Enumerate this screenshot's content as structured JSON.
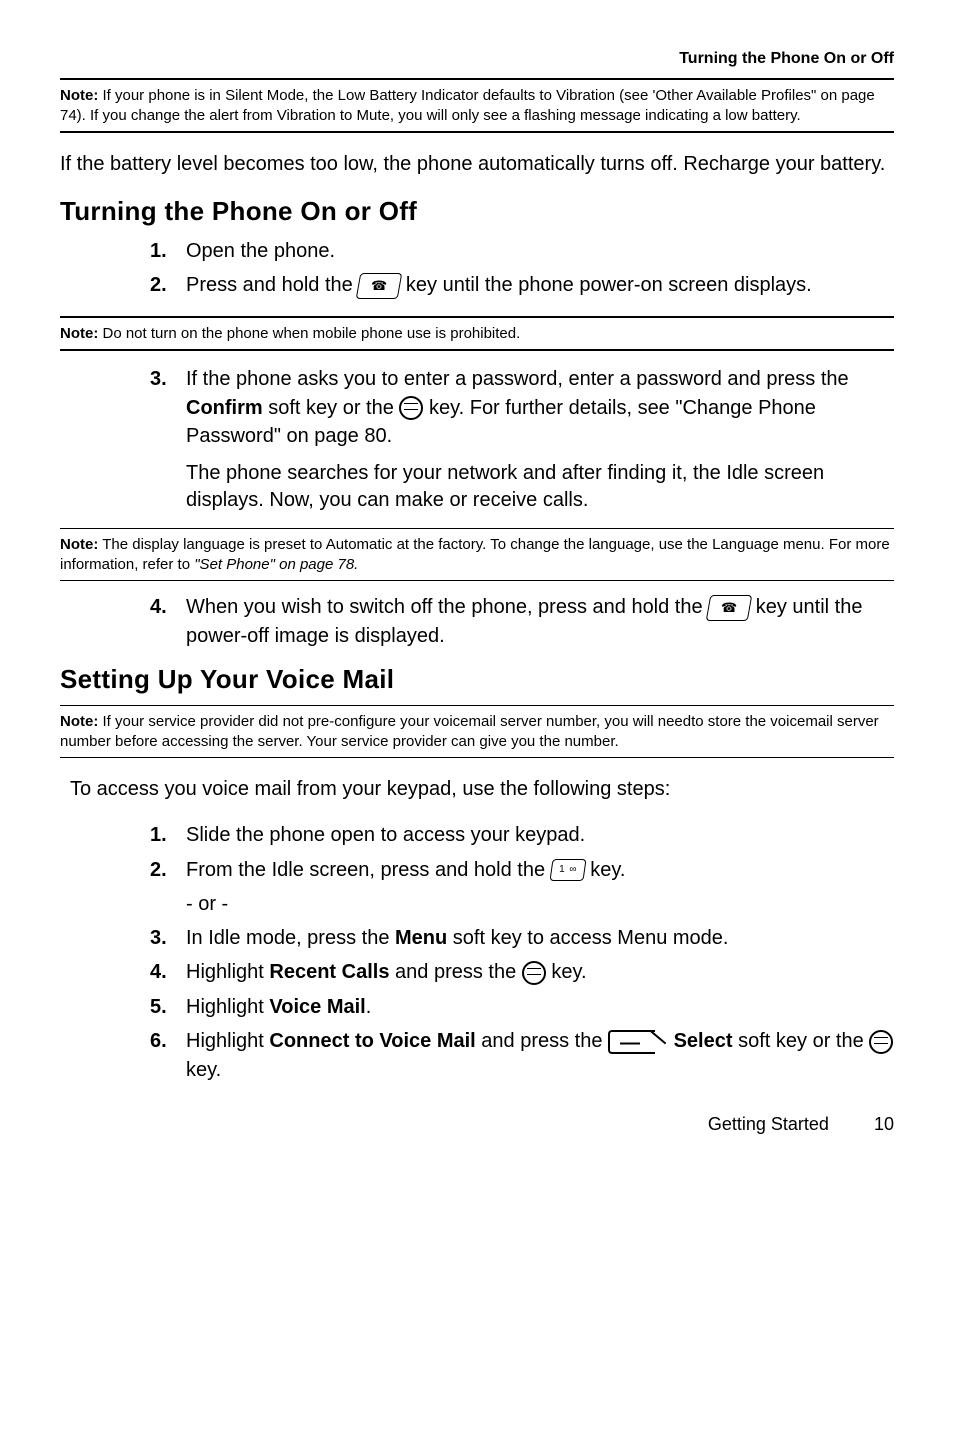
{
  "header": {
    "section_title": "Turning the Phone On or Off"
  },
  "note1": {
    "label": "Note:",
    "text": " If your phone is in Silent Mode, the Low Battery Indicator defaults to Vibration (see 'Other Available Profiles\" on page 74). If you change the alert from Vibration to Mute, you will only see a flashing message indicating a low battery."
  },
  "para1": "If the battery level becomes too low, the phone automatically turns off. Recharge your battery.",
  "heading1": "Turning the Phone On or Off",
  "steps1": {
    "s1": {
      "num": "1.",
      "text": "Open the phone."
    },
    "s2": {
      "num": "2.",
      "pre": "Press and hold the ",
      "post": " key until the phone power-on screen displays."
    }
  },
  "note2": {
    "label": "Note:",
    "text": " Do not turn on the phone when mobile phone use is prohibited."
  },
  "steps2": {
    "s3": {
      "num": "3.",
      "pre": "If the phone asks you to enter a password, enter a password and press the ",
      "confirm": "Confirm",
      "mid": " soft key or the ",
      "post": " key. For further details, see \"Change Phone Password\" on page 80."
    },
    "s3b": "The phone searches for your network and after finding it, the Idle screen displays. Now, you can make or receive calls."
  },
  "note3": {
    "label": "Note:",
    "text_a": " The display language is preset to Automatic at the factory. To change the language, use the Language menu. For more information, refer to ",
    "italic": "\"Set Phone\"  on page 78."
  },
  "steps3": {
    "s4": {
      "num": "4.",
      "pre": "When you wish to switch off the phone, press and hold the ",
      "post": " key until the power-off image is displayed."
    }
  },
  "heading2": "Setting Up Your Voice Mail",
  "note4": {
    "label": "Note:",
    "text": " If your service provider did not pre-configure your voicemail server number, you will needto store the voicemail server number before accessing the server. Your service provider can give you the number."
  },
  "para2": "To access you voice mail from your keypad, use the following steps:",
  "vm": {
    "s1": {
      "num": "1.",
      "text": "Slide the phone open to access your keypad."
    },
    "s2": {
      "num": "2.",
      "pre": "From the Idle screen, press and hold the ",
      "post": " key."
    },
    "or": "- or -",
    "s3": {
      "num": "3.",
      "pre": "In Idle mode, press the ",
      "menu": "Menu",
      "post": " soft key to access Menu mode."
    },
    "s4": {
      "num": "4.",
      "pre": "Highlight ",
      "rc": "Recent Calls",
      "mid": " and press the ",
      "post": " key."
    },
    "s5": {
      "num": "5.",
      "pre": "Highlight ",
      "voicemail": "Voice Mail",
      "post": "."
    },
    "s6": {
      "num": "6.",
      "pre": "Highlight ",
      "conn": "Connect to Voice Mail",
      "mid": " and press the  ",
      "select": "Select",
      "mid2": " soft key or the ",
      "post": " key."
    }
  },
  "footer": {
    "section": "Getting Started",
    "page": "10"
  }
}
